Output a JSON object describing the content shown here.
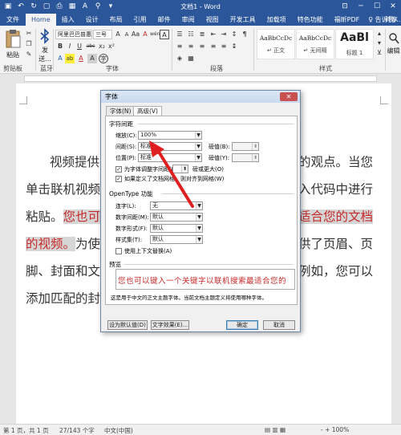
{
  "window": {
    "title": "文档1 - Word",
    "controls": [
      "⊡",
      "─",
      "☐",
      "✕"
    ]
  },
  "ribbon_tabs": {
    "items": [
      "文件",
      "Home",
      "插入",
      "设计",
      "布局",
      "引用",
      "邮件",
      "审阅",
      "视图",
      "开发工具",
      "加载项",
      "特色功能",
      "福昕PDF"
    ],
    "active": "Home",
    "tell_me": "♀ 告诉我...",
    "share": "共享"
  },
  "clipboard": {
    "paste_label": "粘贴",
    "group_label": "剪贴板"
  },
  "bluetooth": {
    "label": "发送...",
    "group_label": "蓝牙"
  },
  "font": {
    "family": "阿里巴巴普惠",
    "size": "三号",
    "size_up": "A",
    "size_down": "A",
    "case": "Aa",
    "clear": "A",
    "wen": "wén",
    "border": "A",
    "bold": "B",
    "italic": "I",
    "underline": "U",
    "strike": "abc",
    "subscript": "x₂",
    "superscript": "x²",
    "highlight": "ab",
    "color": "A",
    "shade": "A",
    "circle": "字",
    "group_label": "字体"
  },
  "paragraph": {
    "group_label": "段落"
  },
  "styles": {
    "items": [
      {
        "sample": "AaBbCcDc",
        "name": "↵ 正文"
      },
      {
        "sample": "AaBbCcDc",
        "name": "↵ 无间隔"
      },
      {
        "sample": "AaBl",
        "name": "标题 1"
      }
    ],
    "group_label": "样式"
  },
  "editing": {
    "label": "编辑"
  },
  "document": {
    "lines": [
      {
        "a": "视频提供",
        "b": "",
        "c": "的观点。当您"
      },
      {
        "a": "单击联机视频",
        "b": "",
        "c": "入代码中进行"
      },
      {
        "a": "粘贴。",
        "b": "您也可",
        "c": "适合您的文档"
      },
      {
        "a": "",
        "b": "的视频。",
        "c": "为使"
      },
      {
        "a": "供了页眉、页",
        "b": "",
        "c": ""
      },
      {
        "a": "脚、封面和文",
        "b": "",
        "c": "例如，您可以"
      },
      {
        "a": "添加匹配的封",
        "b": "",
        "c": ""
      }
    ]
  },
  "dialog": {
    "title": "字体",
    "close": "✕",
    "tabs": [
      "字体(N)",
      "高级(V)"
    ],
    "active_tab": "高级(V)",
    "char_spacing": {
      "heading": "字符间距",
      "scale_label": "缩放(C):",
      "scale_value": "100%",
      "spacing_label": "间距(S):",
      "spacing_value": "标准",
      "spacing_by_label": "磅值(B):",
      "position_label": "位置(P):",
      "position_value": "标准",
      "position_by_label": "磅值(Y):",
      "kerning_label": "为字体调整字间距(K):",
      "kerning_unit": "磅或更大(O)",
      "grid_label": "如果定义了文档网格，则对齐到网格(W)"
    },
    "opentype": {
      "heading": "OpenType 功能",
      "ligatures_label": "连字(L):",
      "ligatures_value": "无",
      "num_spacing_label": "数字间距(M):",
      "num_spacing_value": "默认",
      "num_form_label": "数字形式(F):",
      "num_form_value": "默认",
      "style_set_label": "样式集(T):",
      "style_set_value": "默认",
      "contextual_label": "使用上下文替换(A)"
    },
    "preview": {
      "heading": "预览",
      "text": "您也可以键入一个关键字以联机搜索最适合您的",
      "note": "这是用于中文的正文主题字体。当前文档主题定义将使用哪种字体。"
    },
    "buttons": {
      "set_default": "设为默认值(D)",
      "text_effects": "文字效果(E)...",
      "ok": "确定",
      "cancel": "取消"
    }
  },
  "statusbar": {
    "page": "第 1 页，共 1 页",
    "words": "27/143 个字",
    "lang": "中文(中国)",
    "zoom": "-        +   100%"
  },
  "colors": {
    "word_blue": "#2b579a",
    "highlight_red": "#c62828",
    "arrow_red": "#e02020"
  }
}
